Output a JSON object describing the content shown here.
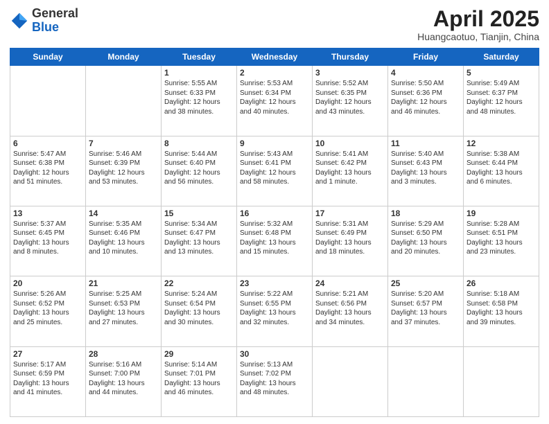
{
  "header": {
    "logo_general": "General",
    "logo_blue": "Blue",
    "month_title": "April 2025",
    "location": "Huangcaotuo, Tianjin, China"
  },
  "days_of_week": [
    "Sunday",
    "Monday",
    "Tuesday",
    "Wednesday",
    "Thursday",
    "Friday",
    "Saturday"
  ],
  "weeks": [
    [
      {
        "day": "",
        "info": ""
      },
      {
        "day": "",
        "info": ""
      },
      {
        "day": "1",
        "info": "Sunrise: 5:55 AM\nSunset: 6:33 PM\nDaylight: 12 hours and 38 minutes."
      },
      {
        "day": "2",
        "info": "Sunrise: 5:53 AM\nSunset: 6:34 PM\nDaylight: 12 hours and 40 minutes."
      },
      {
        "day": "3",
        "info": "Sunrise: 5:52 AM\nSunset: 6:35 PM\nDaylight: 12 hours and 43 minutes."
      },
      {
        "day": "4",
        "info": "Sunrise: 5:50 AM\nSunset: 6:36 PM\nDaylight: 12 hours and 46 minutes."
      },
      {
        "day": "5",
        "info": "Sunrise: 5:49 AM\nSunset: 6:37 PM\nDaylight: 12 hours and 48 minutes."
      }
    ],
    [
      {
        "day": "6",
        "info": "Sunrise: 5:47 AM\nSunset: 6:38 PM\nDaylight: 12 hours and 51 minutes."
      },
      {
        "day": "7",
        "info": "Sunrise: 5:46 AM\nSunset: 6:39 PM\nDaylight: 12 hours and 53 minutes."
      },
      {
        "day": "8",
        "info": "Sunrise: 5:44 AM\nSunset: 6:40 PM\nDaylight: 12 hours and 56 minutes."
      },
      {
        "day": "9",
        "info": "Sunrise: 5:43 AM\nSunset: 6:41 PM\nDaylight: 12 hours and 58 minutes."
      },
      {
        "day": "10",
        "info": "Sunrise: 5:41 AM\nSunset: 6:42 PM\nDaylight: 13 hours and 1 minute."
      },
      {
        "day": "11",
        "info": "Sunrise: 5:40 AM\nSunset: 6:43 PM\nDaylight: 13 hours and 3 minutes."
      },
      {
        "day": "12",
        "info": "Sunrise: 5:38 AM\nSunset: 6:44 PM\nDaylight: 13 hours and 6 minutes."
      }
    ],
    [
      {
        "day": "13",
        "info": "Sunrise: 5:37 AM\nSunset: 6:45 PM\nDaylight: 13 hours and 8 minutes."
      },
      {
        "day": "14",
        "info": "Sunrise: 5:35 AM\nSunset: 6:46 PM\nDaylight: 13 hours and 10 minutes."
      },
      {
        "day": "15",
        "info": "Sunrise: 5:34 AM\nSunset: 6:47 PM\nDaylight: 13 hours and 13 minutes."
      },
      {
        "day": "16",
        "info": "Sunrise: 5:32 AM\nSunset: 6:48 PM\nDaylight: 13 hours and 15 minutes."
      },
      {
        "day": "17",
        "info": "Sunrise: 5:31 AM\nSunset: 6:49 PM\nDaylight: 13 hours and 18 minutes."
      },
      {
        "day": "18",
        "info": "Sunrise: 5:29 AM\nSunset: 6:50 PM\nDaylight: 13 hours and 20 minutes."
      },
      {
        "day": "19",
        "info": "Sunrise: 5:28 AM\nSunset: 6:51 PM\nDaylight: 13 hours and 23 minutes."
      }
    ],
    [
      {
        "day": "20",
        "info": "Sunrise: 5:26 AM\nSunset: 6:52 PM\nDaylight: 13 hours and 25 minutes."
      },
      {
        "day": "21",
        "info": "Sunrise: 5:25 AM\nSunset: 6:53 PM\nDaylight: 13 hours and 27 minutes."
      },
      {
        "day": "22",
        "info": "Sunrise: 5:24 AM\nSunset: 6:54 PM\nDaylight: 13 hours and 30 minutes."
      },
      {
        "day": "23",
        "info": "Sunrise: 5:22 AM\nSunset: 6:55 PM\nDaylight: 13 hours and 32 minutes."
      },
      {
        "day": "24",
        "info": "Sunrise: 5:21 AM\nSunset: 6:56 PM\nDaylight: 13 hours and 34 minutes."
      },
      {
        "day": "25",
        "info": "Sunrise: 5:20 AM\nSunset: 6:57 PM\nDaylight: 13 hours and 37 minutes."
      },
      {
        "day": "26",
        "info": "Sunrise: 5:18 AM\nSunset: 6:58 PM\nDaylight: 13 hours and 39 minutes."
      }
    ],
    [
      {
        "day": "27",
        "info": "Sunrise: 5:17 AM\nSunset: 6:59 PM\nDaylight: 13 hours and 41 minutes."
      },
      {
        "day": "28",
        "info": "Sunrise: 5:16 AM\nSunset: 7:00 PM\nDaylight: 13 hours and 44 minutes."
      },
      {
        "day": "29",
        "info": "Sunrise: 5:14 AM\nSunset: 7:01 PM\nDaylight: 13 hours and 46 minutes."
      },
      {
        "day": "30",
        "info": "Sunrise: 5:13 AM\nSunset: 7:02 PM\nDaylight: 13 hours and 48 minutes."
      },
      {
        "day": "",
        "info": ""
      },
      {
        "day": "",
        "info": ""
      },
      {
        "day": "",
        "info": ""
      }
    ]
  ]
}
